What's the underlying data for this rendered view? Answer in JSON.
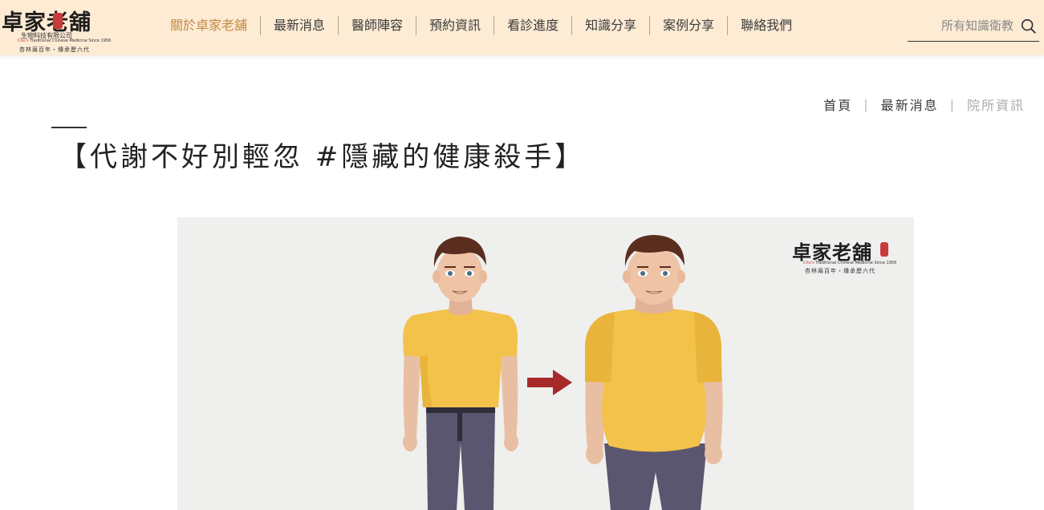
{
  "header": {
    "logo": {
      "brand": "卓家老舖",
      "company": "生物科技有限公司",
      "english_prefix": "Cho's",
      "english": " Traditional Chinese Medicine Since 1956",
      "slogan": "杏林兩百年・傳承歷六代"
    },
    "nav": [
      {
        "label": "關於卓家老舖",
        "active": true
      },
      {
        "label": "最新消息"
      },
      {
        "label": "醫師陣容"
      },
      {
        "label": "預約資訊"
      },
      {
        "label": "看診進度"
      },
      {
        "label": "知識分享"
      },
      {
        "label": "案例分享"
      },
      {
        "label": "聯絡我們"
      }
    ],
    "search": {
      "placeholder": "所有知識衛教",
      "value": ""
    }
  },
  "breadcrumb": {
    "items": [
      "首頁",
      "最新消息"
    ],
    "current": "院所資訊"
  },
  "article": {
    "title": "【代謝不好別輕忽 #隱藏的健康殺手】"
  },
  "hero_image": {
    "logo_brand": "卓家老舖",
    "logo_english_prefix": "Cho's",
    "logo_english": " Traditional Chinese Medicine Since 1956",
    "logo_slogan": "杏林兩百年・傳承歷六代"
  },
  "colors": {
    "header_bg": "#fdebd4",
    "nav_active": "#c28a45",
    "shirt": "#f2c24a",
    "pants": "#5a566f",
    "arrow": "#a72a2a"
  }
}
